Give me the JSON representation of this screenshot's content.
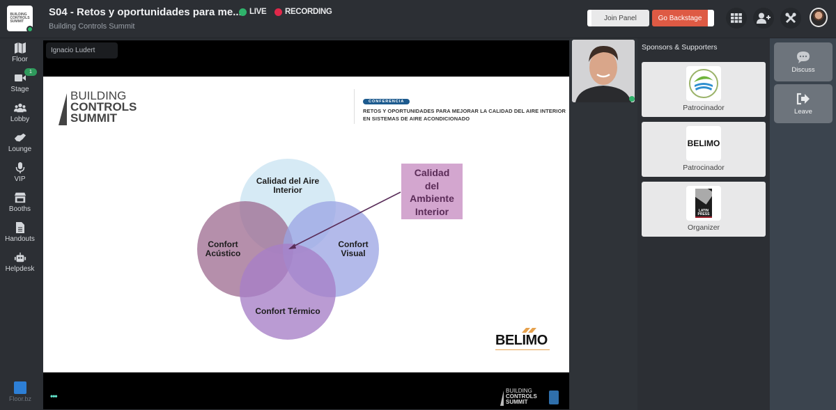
{
  "header": {
    "title": "S04 - Retos y oportunidades para me...",
    "subtitle": "Building Controls Summit",
    "logo_text": [
      "BUILDING",
      "CONTROLS",
      "SUMMIT"
    ],
    "live_label": "LIVE",
    "recording_label": "RECORDING",
    "join_panel_label": "Join Panel",
    "go_backstage_label": "Go Backstage",
    "icons": [
      "grid-icon",
      "add-user-icon",
      "tools-icon",
      "user-avatar"
    ],
    "colors": {
      "live": "#2fb36b",
      "recording": "#e0284a",
      "backstage": "#de5a44"
    }
  },
  "leftnav": {
    "items": [
      {
        "label": "Floor",
        "icon": "map-icon"
      },
      {
        "label": "Stage",
        "icon": "video-camera-icon",
        "badge": "1"
      },
      {
        "label": "Lobby",
        "icon": "people-icon"
      },
      {
        "label": "Lounge",
        "icon": "handshake-icon"
      },
      {
        "label": "VIP",
        "icon": "microphone-icon"
      },
      {
        "label": "Booths",
        "icon": "store-icon"
      },
      {
        "label": "Handouts",
        "icon": "document-icon"
      },
      {
        "label": "Helpdesk",
        "icon": "robot-icon"
      }
    ],
    "footer_label": "Floor.bz"
  },
  "stage": {
    "speaker_name": "Ignacio Ludert",
    "slide": {
      "logo_lines": [
        "BUILDING",
        "CONTROLS",
        "SUMMIT"
      ],
      "conference_pill": "CONFERENCIA",
      "conference_title_1": "RETOS Y OPORTUNIDADES PARA MEJORAR LA CALIDAD DEL AIRE INTERIOR",
      "conference_title_2": "EN SISTEMAS DE AIRE ACONDICIONADO",
      "venn": {
        "top": [
          "Calidad del Aire",
          "Interior"
        ],
        "left": [
          "Confort",
          "Acústico"
        ],
        "right": [
          "Confort",
          "Visual"
        ],
        "bottom": [
          "Confort Térmico"
        ]
      },
      "callout": [
        "Calidad",
        "del",
        "Ambiente",
        "Interior"
      ],
      "brand": "BELIMO"
    },
    "menu_dots": "•••",
    "footer_logo_lines": [
      "BUILDING",
      "CONTROLS",
      "SUMMIT"
    ]
  },
  "sponsors": {
    "heading": "Sponsors & Supporters",
    "cards": [
      {
        "caption": "Patrocinador",
        "logo": "reliable-controls-logo"
      },
      {
        "caption": "Patrocinador",
        "logo": "belimo-logo",
        "logo_text": "BELIMO"
      },
      {
        "caption": "Organizer",
        "logo": "latin-press-logo",
        "logo_text": "LATIN PRESS"
      }
    ]
  },
  "actions": {
    "discuss_label": "Discuss",
    "leave_label": "Leave"
  }
}
